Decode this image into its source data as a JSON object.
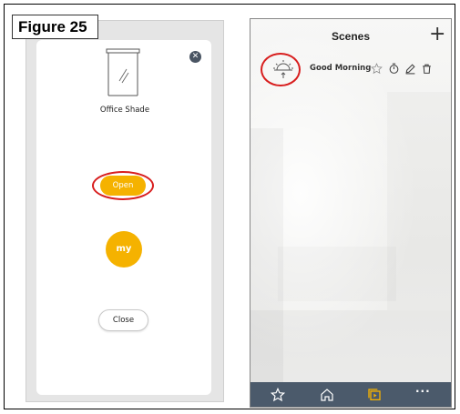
{
  "figure": {
    "label": "Figure 25"
  },
  "left_screen": {
    "device_name": "Office Shade",
    "open_label": "Open",
    "my_label": "my",
    "close_label": "Close",
    "accent_color": "#f5b200",
    "highlight_color": "#d81e1e",
    "icons": [
      "close-icon",
      "window-shade-icon"
    ]
  },
  "right_screen": {
    "title": "Scenes",
    "add_label": "+",
    "scenes": [
      {
        "name": "Good Morning",
        "icons": [
          "sunrise-icon",
          "favorite-star-icon",
          "timer-icon",
          "edit-pencil-icon",
          "delete-trash-icon"
        ]
      }
    ],
    "bottom_tabs": [
      {
        "name": "favorites",
        "icon": "star-icon"
      },
      {
        "name": "home",
        "icon": "home-icon"
      },
      {
        "name": "scenes",
        "icon": "scenes-icon",
        "active_color": "#f5b200"
      },
      {
        "name": "more",
        "label": "···",
        "icon": "more-icon"
      }
    ],
    "bar_color": "#4b5a6b"
  }
}
